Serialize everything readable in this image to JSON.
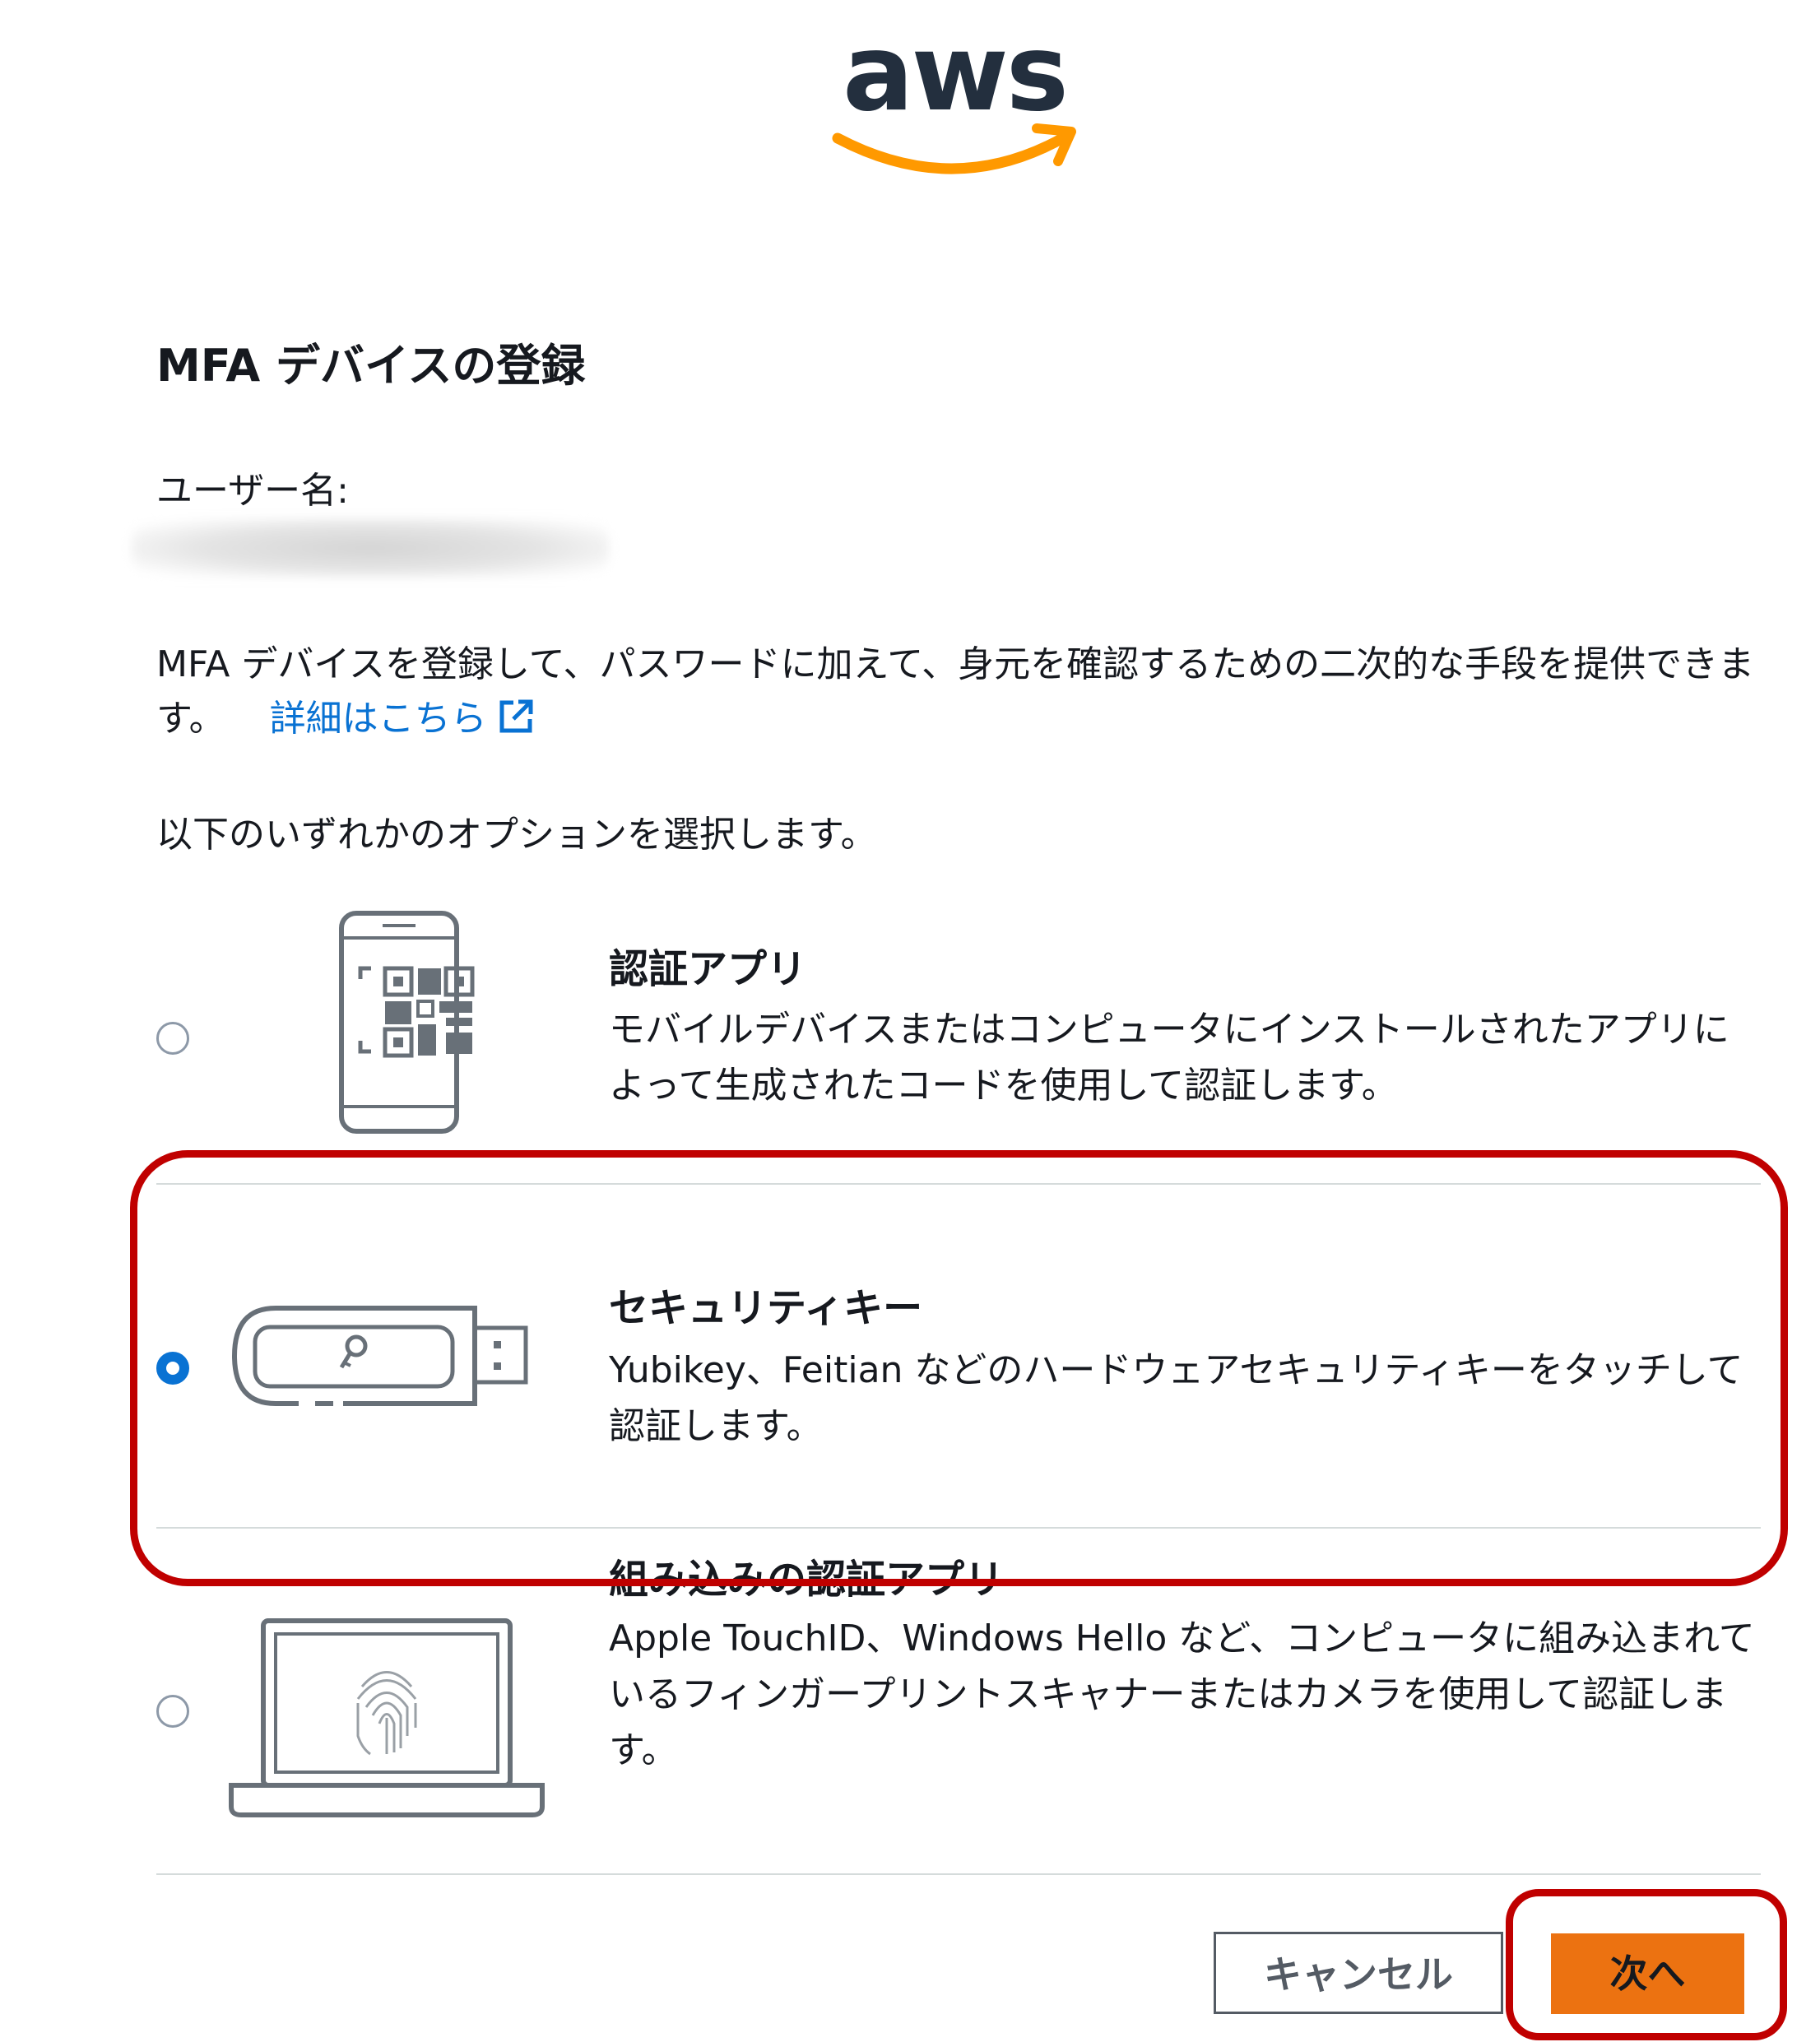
{
  "logo": {
    "text": "aws"
  },
  "page": {
    "title": "MFA デバイスの登録",
    "username_label": "ユーザー名:",
    "description": "MFA デバイスを登録して、パスワードに加えて、身元を確認するための二次的な手段を提供できます。",
    "learn_more": "詳細はこちら",
    "select_prompt": "以下のいずれかのオプションを選択します。"
  },
  "options": [
    {
      "title": "認証アプリ",
      "description": "モバイルデバイスまたはコンピュータにインストールされたアプリによって生成されたコードを使用して認証します。",
      "selected": false,
      "icon": "qr-phone-icon"
    },
    {
      "title": "セキュリティキー",
      "description": "Yubikey、Feitian などのハードウェアセキュリティキーをタッチして認証します。",
      "selected": true,
      "icon": "usb-security-key-icon"
    },
    {
      "title": "組み込みの認証アプリ",
      "description": "Apple TouchID、Windows Hello など、コンピュータに組み込まれているフィンガープリントスキャナーまたはカメラを使用して認証します。",
      "selected": false,
      "icon": "laptop-fingerprint-icon"
    }
  ],
  "buttons": {
    "cancel": "キャンセル",
    "next": "次へ"
  },
  "colors": {
    "accent": "#ec7211",
    "link": "#0972d3",
    "highlight": "#c00000",
    "logo_dark": "#232f3e",
    "logo_smile": "#ff9900"
  }
}
